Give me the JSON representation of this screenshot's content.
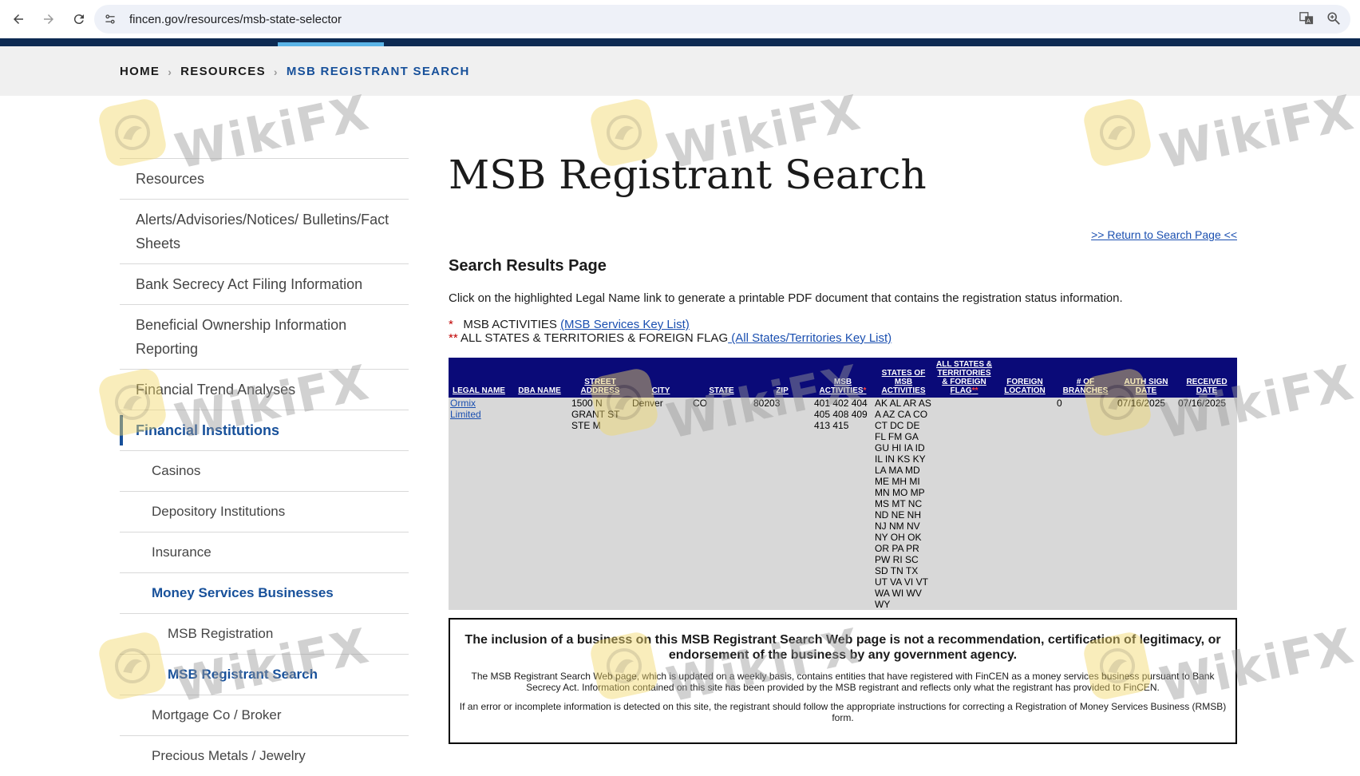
{
  "browser": {
    "url": "fincen.gov/resources/msb-state-selector"
  },
  "breadcrumb": [
    "HOME",
    "RESOURCES",
    "MSB REGISTRANT SEARCH"
  ],
  "sidebar": {
    "items": [
      {
        "label": "Resources",
        "level": 1
      },
      {
        "label": "Alerts/Advisories/Notices/ Bulletins/Fact Sheets",
        "level": 1
      },
      {
        "label": "Bank Secrecy Act Filing Information",
        "level": 1
      },
      {
        "label": "Beneficial Ownership Information Reporting",
        "level": 1
      },
      {
        "label": "Financial Trend Analyses",
        "level": 1
      },
      {
        "label": "Financial Institutions",
        "level": 1,
        "active": true
      },
      {
        "label": "Casinos",
        "level": 2
      },
      {
        "label": "Depository Institutions",
        "level": 2
      },
      {
        "label": "Insurance",
        "level": 2
      },
      {
        "label": "Money Services Businesses",
        "level": 2,
        "active": true
      },
      {
        "label": "MSB Registration",
        "level": 3
      },
      {
        "label": "MSB Registrant Search",
        "level": 3,
        "active": true
      },
      {
        "label": "Mortgage Co / Broker",
        "level": 2
      },
      {
        "label": "Precious Metals / Jewelry",
        "level": 2
      }
    ]
  },
  "main": {
    "title": "MSB Registrant Search",
    "return_link": ">> Return to Search Page <<",
    "results_heading": "Search Results Page",
    "instruction": "Click on the highlighted Legal Name link to generate a printable PDF document that contains the registration status information.",
    "key1": {
      "star": "*",
      "label": "MSB ACTIVITIES",
      "link": "(MSB Services Key List)"
    },
    "key2": {
      "star": "**",
      "label": "ALL STATES & TERRITORIES & FOREIGN FLAG",
      "link": " (All States/Territories Key List)"
    }
  },
  "table": {
    "headers": [
      "LEGAL NAME",
      "DBA NAME",
      "STREET ADDRESS",
      "CITY",
      "STATE",
      "ZIP",
      "MSB ACTIVITIES",
      "STATES OF MSB ACTIVITIES",
      "ALL STATES & TERRITORIES & FOREIGN FLAG",
      "FOREIGN LOCATION",
      "# OF BRANCHES",
      "AUTH SIGN DATE",
      "RECEIVED DATE"
    ],
    "header_stars": {
      "msb_activities": "*",
      "all_states": "**"
    },
    "row": {
      "legal_name": "Ormix Limited",
      "dba_name": "",
      "street": "1500 N GRANT ST STE M",
      "city": "Denver",
      "state": "CO",
      "zip": "80203",
      "activities": "401 402 404 405 408 409 413 415",
      "states": "AK AL AR AS A AZ CA CO CT DC DE FL FM GA GU HI IA ID IL IN KS KY LA MA MD ME MH MI MN MO MP MS MT NC ND NE NH NJ NM NV NY OH OK OR PA PR PW RI SC SD TN TX UT VA VI VT WA WI WV WY",
      "all_states": "",
      "foreign_location": "",
      "branches": "0",
      "auth_date": "07/16/2025",
      "received_date": "07/16/2025"
    }
  },
  "disclaimer": {
    "heading": "The inclusion of a business on this MSB Registrant Search Web page is not a recommendation, certification of legitimacy, or endorsement of the business by any government agency.",
    "p1": "The MSB Registrant Search Web page, which is updated on a weekly basis, contains entities that have registered with FinCEN as a money services business pursuant to Bank Secrecy Act. Information contained on this site has been provided by the MSB registrant and reflects only what the registrant has provided to FinCEN.",
    "p2": "If an error or incomplete information is detected on this site, the registrant should follow the appropriate instructions for correcting a Registration of Money Services Business (RMSB) form."
  },
  "watermark": {
    "text": "WikiFX"
  },
  "colors": {
    "navy": "#0d2a52",
    "table_header": "#0a0a78",
    "link": "#1a4fb0",
    "active_nav": "#17509a",
    "row_bg": "#d8d8d8"
  }
}
